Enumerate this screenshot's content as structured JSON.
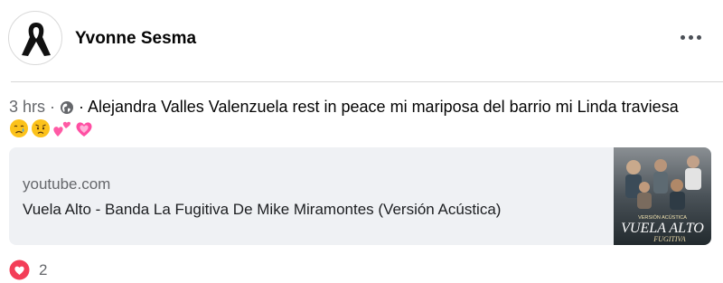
{
  "post": {
    "author": "Yvonne Sesma",
    "time": "3 hrs",
    "separator": " · ",
    "caption": " · Alejandra Valles Valenzuela rest in peace mi mariposa del barrio mi Linda traviesa",
    "emojis": [
      "crying-face",
      "sad-relieved-face",
      "two-hearts",
      "sparkling-heart"
    ]
  },
  "link_preview": {
    "domain": "youtube.com",
    "title": "Vuela Alto - Banda La Fugitiva De Mike Miramontes (Versión Acústica)",
    "thumbnail_text": {
      "subtitle": "VERSIÓN ACÚSTICA",
      "title": "VUELA ALTO",
      "band": "FUGITIVA"
    }
  },
  "reactions": {
    "icon": "heart-reaction-icon",
    "count": "2",
    "color": "#f33e58"
  },
  "colors": {
    "secondary_text": "#65676b",
    "card_background": "#eff1f4"
  }
}
